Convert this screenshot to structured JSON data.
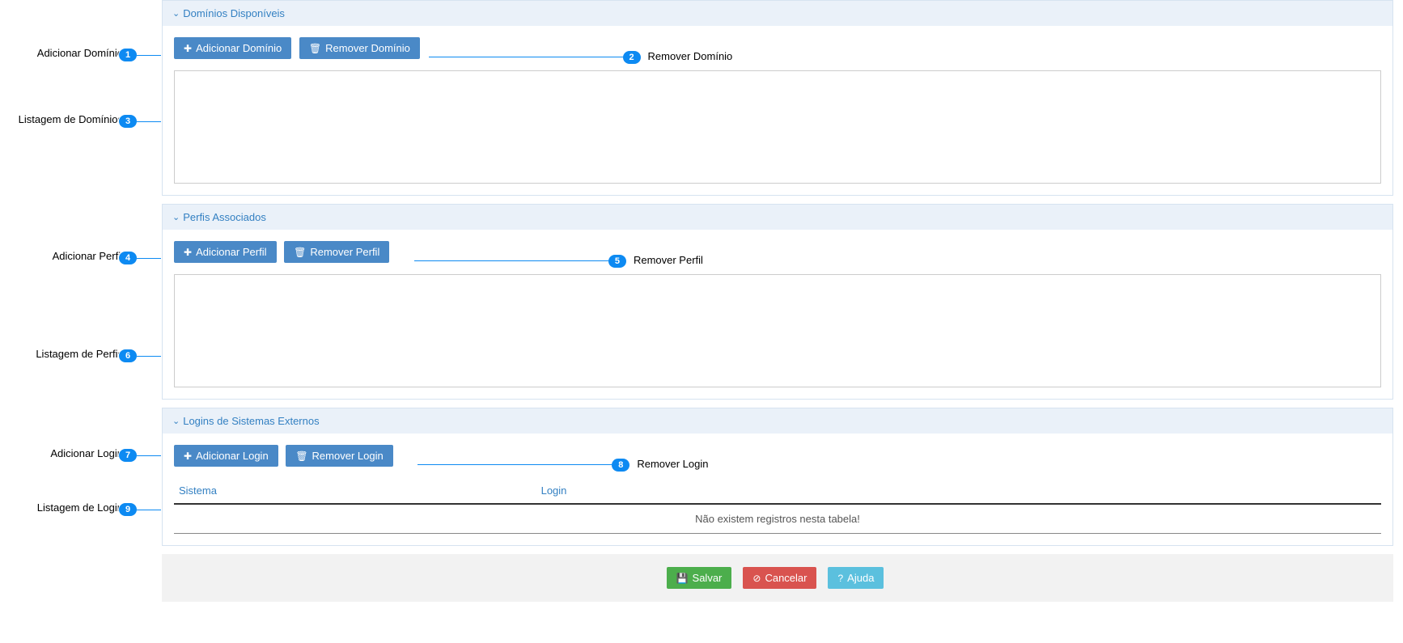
{
  "annotations": {
    "a1": "Adicionar Domínio",
    "a2": "Remover Domínio",
    "a3": "Listagem de Domínios",
    "a4": "Adicionar Perfil",
    "a5": "Remover Perfil",
    "a6": "Listagem de Perfis",
    "a7": "Adicionar Login",
    "a8": "Remover Login",
    "a9": "Listagem de Login"
  },
  "panel_domains": {
    "title": "Domínios Disponíveis",
    "btn_add": "Adicionar Domínio",
    "btn_remove": "Remover Domínio"
  },
  "panel_profiles": {
    "title": "Perfis Associados",
    "btn_add": "Adicionar Perfil",
    "btn_remove": "Remover Perfil"
  },
  "panel_logins": {
    "title": "Logins de Sistemas Externos",
    "btn_add": "Adicionar Login",
    "btn_remove": "Remover Login",
    "col_sistema": "Sistema",
    "col_login": "Login",
    "empty_msg": "Não existem registros nesta tabela!"
  },
  "footer": {
    "save": "Salvar",
    "cancel": "Cancelar",
    "help": "Ajuda"
  }
}
